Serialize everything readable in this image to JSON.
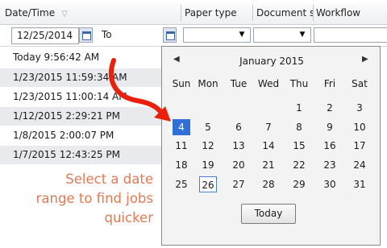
{
  "header": {
    "date_time": "Date/Time",
    "paper_type": "Paper type",
    "document_size": "Document s",
    "workflow": "Workflow"
  },
  "filter": {
    "from_date": "12/25/2014",
    "to_label": "To"
  },
  "rows": [
    "Today 9:56:42 AM",
    "1/23/2015 11:59:34 AM",
    "1/23/2015 11:00:14 AM",
    "1/12/2015 2:29:21 PM",
    "1/8/2015 2:00:07 PM",
    "1/7/2015 12:43:25 PM"
  ],
  "callout": {
    "line1": "Select a date",
    "line2": "range to find jobs",
    "line3": "quicker",
    "color": "#e07a52"
  },
  "calendar": {
    "month_title": "January 2015",
    "prev": "◀",
    "next": "▶",
    "weekdays": [
      "Sun",
      "Mon",
      "Tue",
      "Wed",
      "Thu",
      "Fri",
      "Sat"
    ],
    "weeks": [
      [
        "",
        "",
        "",
        "",
        "1",
        "2",
        "3"
      ],
      [
        "4",
        "5",
        "6",
        "7",
        "8",
        "9",
        "10"
      ],
      [
        "11",
        "12",
        "13",
        "14",
        "15",
        "16",
        "17"
      ],
      [
        "18",
        "19",
        "20",
        "21",
        "22",
        "23",
        "24"
      ],
      [
        "25",
        "26",
        "27",
        "28",
        "29",
        "30",
        "31"
      ]
    ],
    "selected_day": "4",
    "today_day": "26",
    "today_button": "Today",
    "accent": "#2f6fd6"
  },
  "arrow_color": "#e8200c"
}
